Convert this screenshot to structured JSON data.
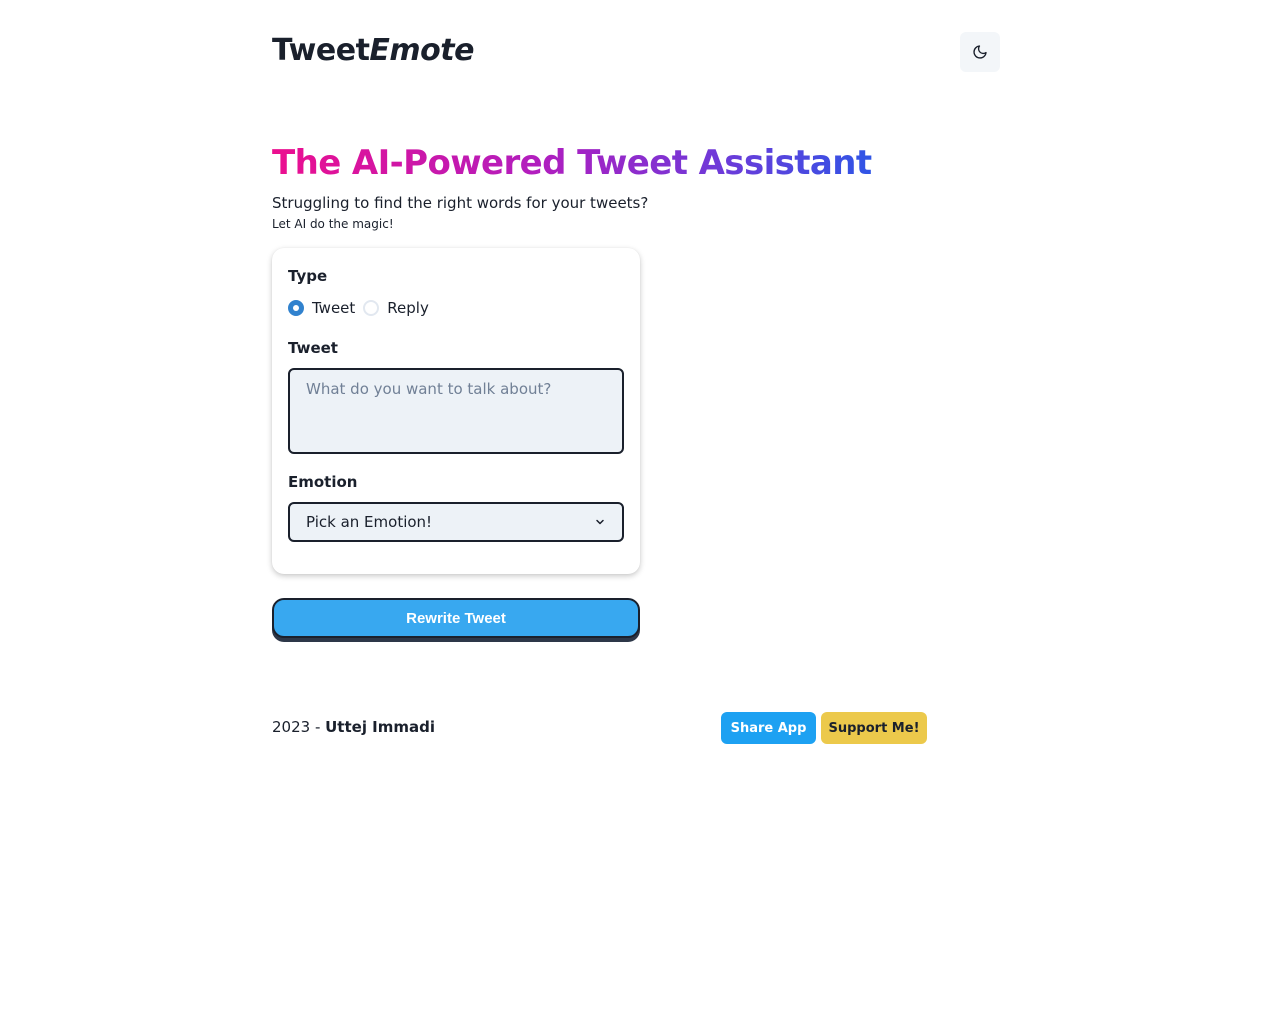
{
  "header": {
    "logo_main": "Tweet",
    "logo_italic": "Emote",
    "theme_toggle_icon": "moon-icon"
  },
  "hero": {
    "title": "The AI-Powered Tweet Assistant",
    "subtitle": "Struggling to find the right words for your tweets?",
    "tagline": "Let AI do the magic!",
    "gradient_colors": [
      "#ec0f8f",
      "#b01ebf",
      "#6d3ad9",
      "#2f55e6"
    ]
  },
  "form": {
    "type_label": "Type",
    "type_options": [
      {
        "label": "Tweet",
        "checked": true
      },
      {
        "label": "Reply",
        "checked": false
      }
    ],
    "tweet_label": "Tweet",
    "tweet_placeholder": "What do you want to talk about?",
    "tweet_value": "",
    "emotion_label": "Emotion",
    "emotion_selected": "Pick an Emotion!",
    "submit_label": "Rewrite Tweet"
  },
  "footer": {
    "year": "2023 - ",
    "author": "Uttej Immadi",
    "share_label": "Share App",
    "support_label": "Support Me!"
  },
  "colors": {
    "accent_blue": "#38a8f0",
    "share_blue": "#1da1f2",
    "support_yellow": "#ecc94b",
    "radio_checked": "#3182ce"
  }
}
